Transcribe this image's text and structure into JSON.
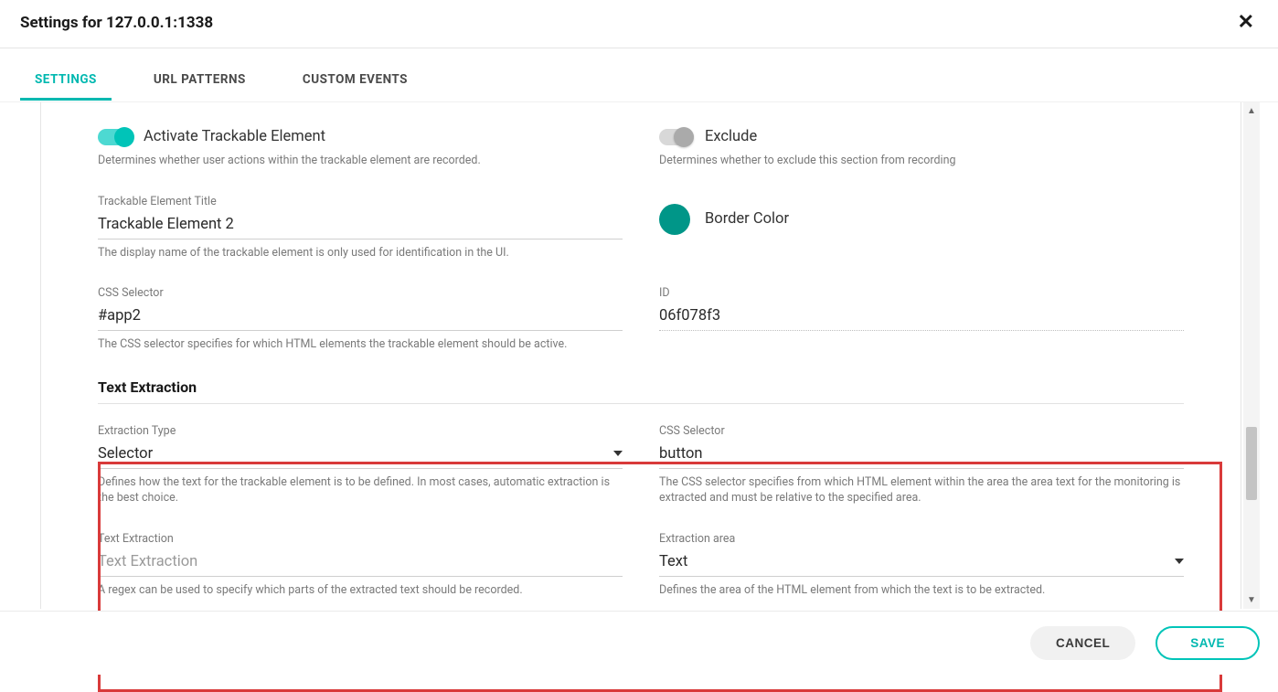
{
  "header": {
    "title": "Settings for 127.0.0.1:1338"
  },
  "tabs": {
    "settings": "SETTINGS",
    "url_patterns": "URL PATTERNS",
    "custom_events": "CUSTOM EVENTS"
  },
  "activate": {
    "label": "Activate Trackable Element",
    "helper": "Determines whether user actions within the trackable element are recorded."
  },
  "exclude": {
    "label": "Exclude",
    "helper": "Determines whether to exclude this section from recording"
  },
  "element_title": {
    "label": "Trackable Element Title",
    "value": "Trackable Element 2",
    "helper": "The display name of the trackable element is only used for identification in the UI."
  },
  "border_color": {
    "label": "Border Color",
    "hex": "#009688"
  },
  "css_selector_main": {
    "label": "CSS Selector",
    "value": "#app2",
    "helper": "The CSS selector specifies for which HTML elements the trackable element should be active."
  },
  "id_field": {
    "label": "ID",
    "value": "06f078f3"
  },
  "section_text_extraction": "Text Extraction",
  "extraction_type": {
    "label": "Extraction Type",
    "value": "Selector",
    "helper": "Defines how the text for the trackable element is to be defined. In most cases, automatic extraction is the best choice."
  },
  "css_selector_extract": {
    "label": "CSS Selector",
    "value": "button",
    "helper": "The CSS selector specifies from which HTML element within the area the area text for the monitoring is extracted and must be relative to the specified area."
  },
  "text_extraction": {
    "label": "Text Extraction",
    "placeholder": "Text Extraction",
    "helper": "A regex can be used to specify which parts of the extracted text should be recorded."
  },
  "extraction_area": {
    "label": "Extraction area",
    "value": "Text",
    "helper": "Defines the area of the HTML element from which the text is to be extracted."
  },
  "footer": {
    "cancel": "CANCEL",
    "save": "SAVE"
  }
}
